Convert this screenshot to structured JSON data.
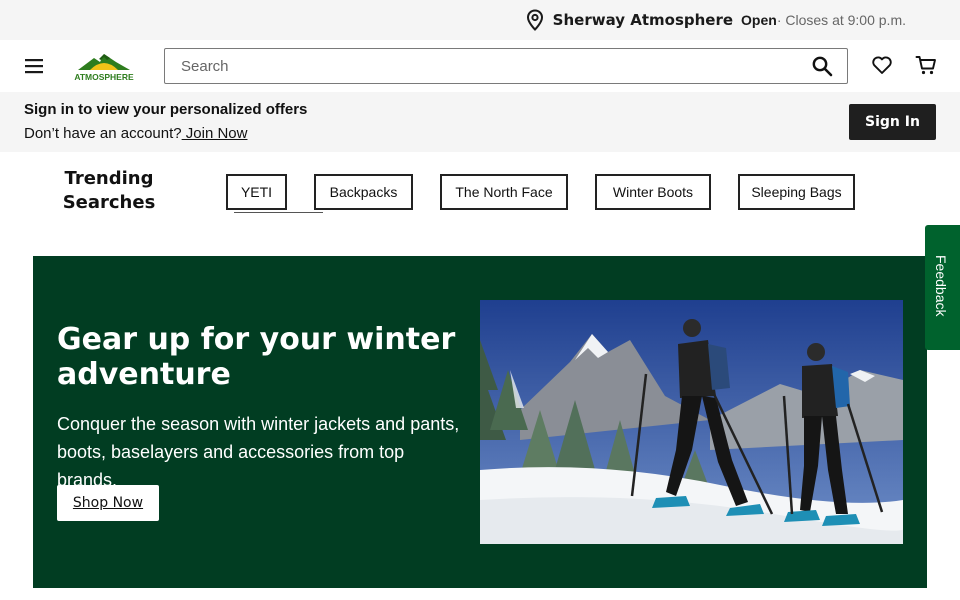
{
  "store": {
    "name": "Sherway Atmosphere",
    "status": "Open",
    "hours": "· Closes at 9:00 p.m."
  },
  "header": {
    "logo_text": "ATMOSPHERE",
    "search_placeholder": "Search"
  },
  "account": {
    "title": "Sign in to view your personalized offers",
    "prompt": "Don’t have an account?",
    "join_label": " Join Now",
    "signin_label": "Sign In"
  },
  "trending": {
    "title": "Trending Searches",
    "items": [
      "YETI",
      "Backpacks",
      "The North Face",
      "Winter Boots",
      "Sleeping Bags"
    ]
  },
  "hero": {
    "title": "Gear up for your winter adventure",
    "body": "Conquer the season with winter jackets and pants, boots, baselayers and accessories from top brands.",
    "cta_label": "Shop Now"
  },
  "feedback": {
    "label": "Feedback"
  },
  "colors": {
    "hero_bg": "#013d22",
    "feedback_bg": "#00622d",
    "strip_bg": "#f5f5f5",
    "logo_green": "#2e7d1e",
    "logo_yellow": "#f2c318"
  },
  "icons": [
    "location-pin-icon",
    "menu-icon",
    "search-icon",
    "heart-icon",
    "cart-icon"
  ]
}
